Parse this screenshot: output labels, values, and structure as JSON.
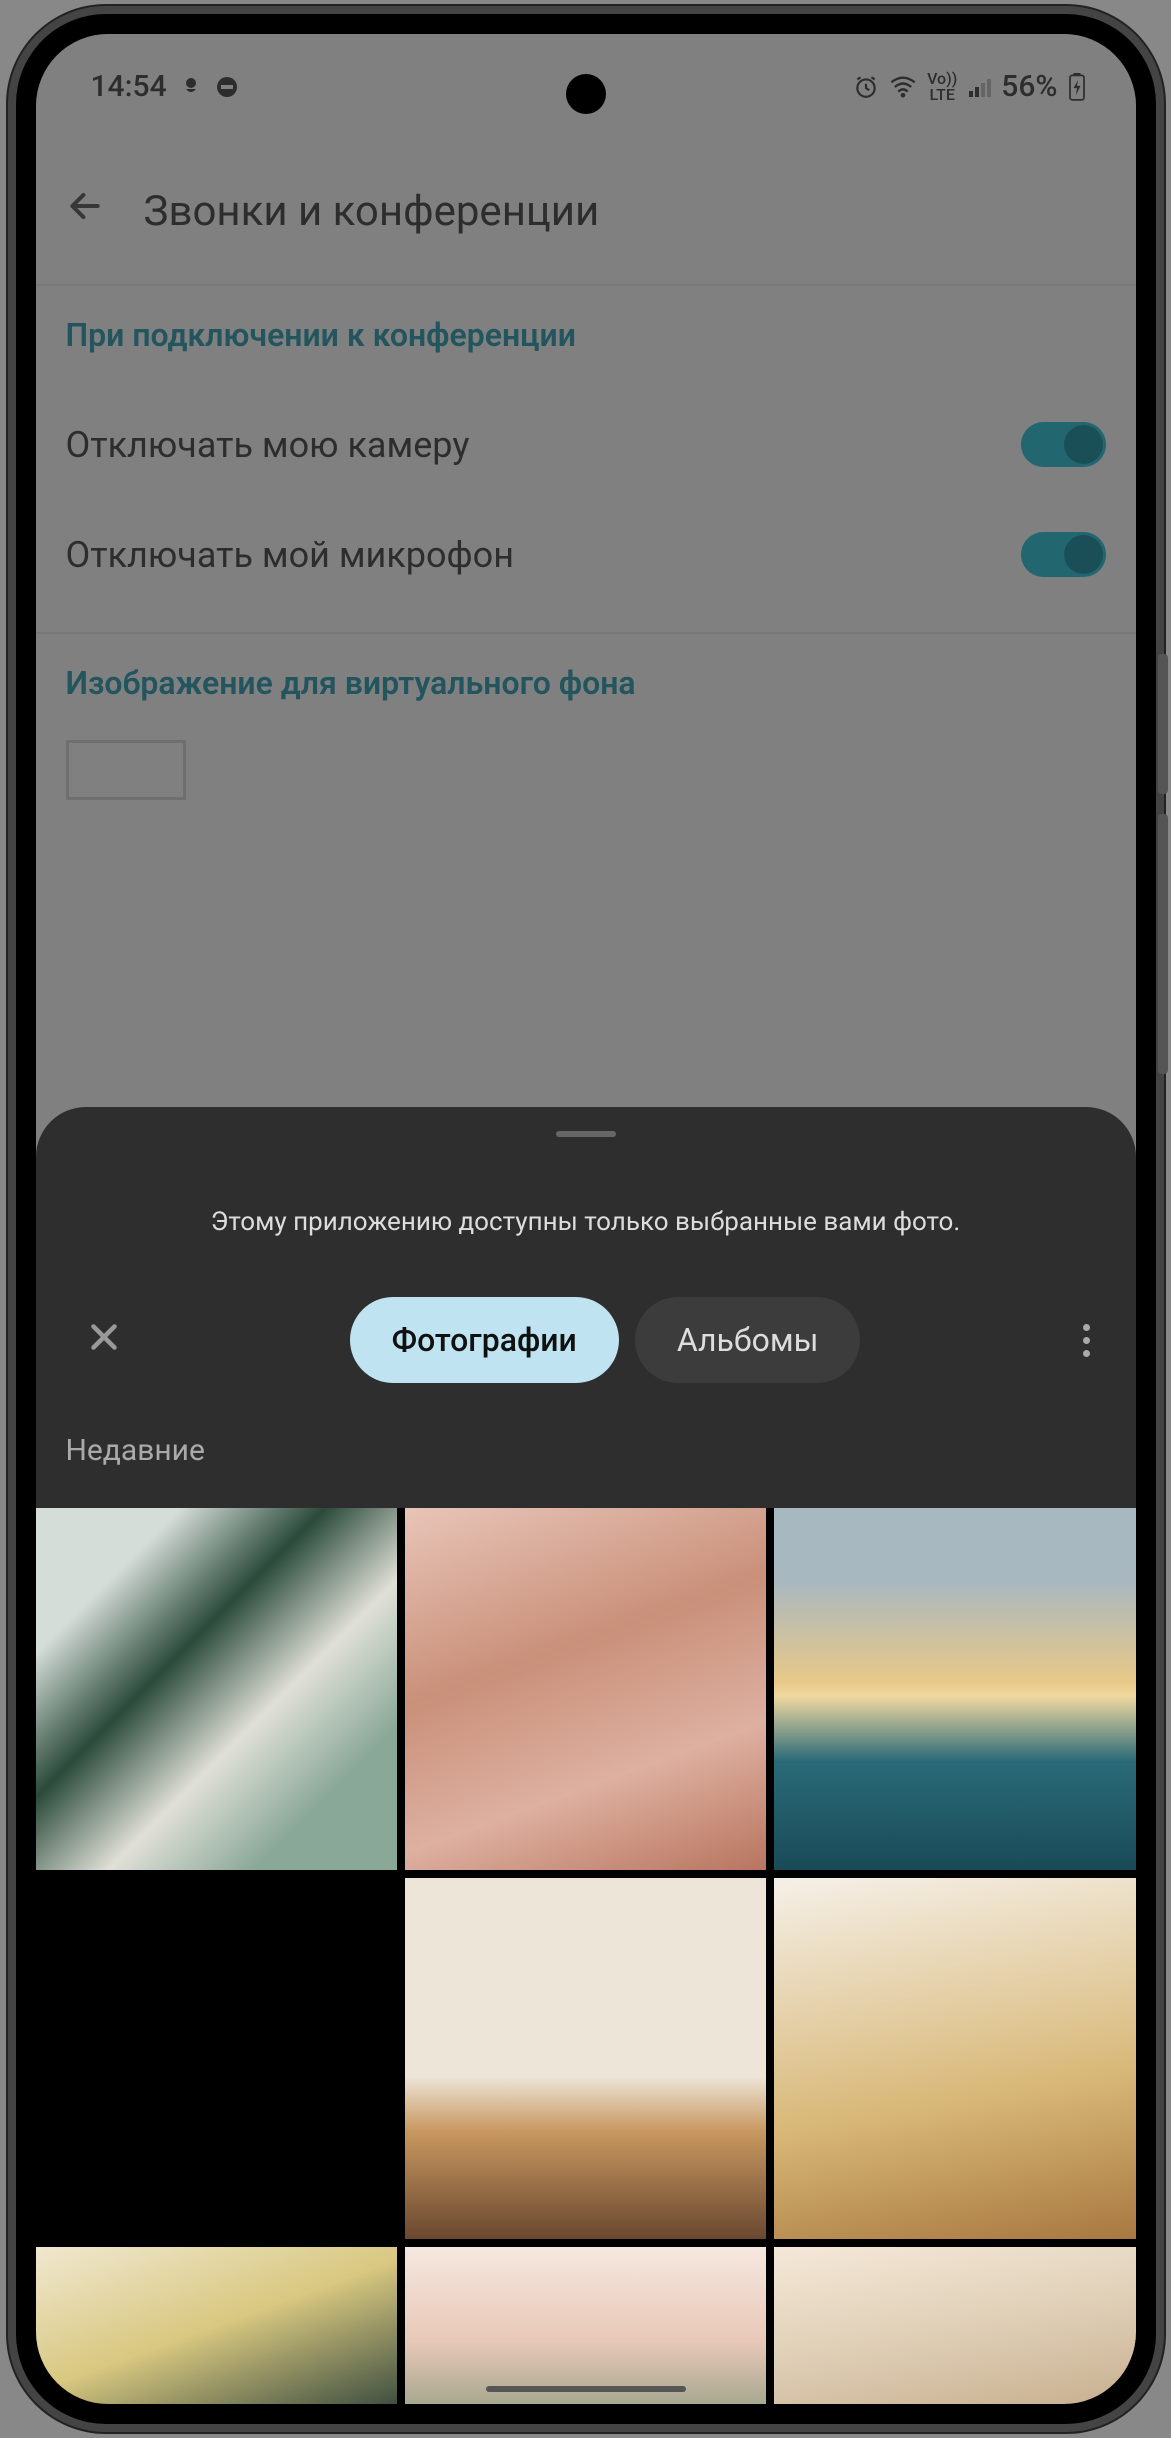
{
  "status": {
    "time": "14:54",
    "battery": "56%",
    "lte": "LTE",
    "vo": "Vo))"
  },
  "app": {
    "title": "Звонки и конференции"
  },
  "settings": {
    "section1_title": "При подключении к конференции",
    "disable_camera": "Отключать мою камеру",
    "disable_mic": "Отключать мой микрофон",
    "section2_title": "Изображение для виртуального фона"
  },
  "sheet": {
    "message": "Этому приложению доступны только выбранные вами фото.",
    "tab_photos": "Фотографии",
    "tab_albums": "Альбомы",
    "recent": "Недавние"
  }
}
